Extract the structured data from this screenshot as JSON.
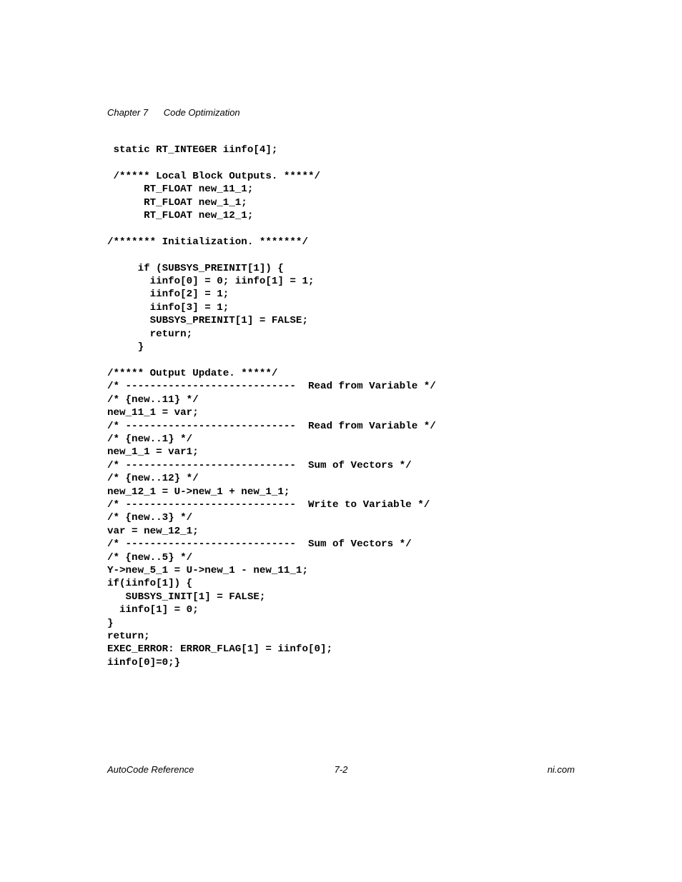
{
  "header": {
    "chapter_label": "Chapter 7",
    "chapter_title": "Code Optimization"
  },
  "code": " static RT_INTEGER iinfo[4];\n\n /***** Local Block Outputs. *****/\n      RT_FLOAT new_11_1;\n      RT_FLOAT new_1_1;\n      RT_FLOAT new_12_1;\n\n/******* Initialization. *******/\n\n     if (SUBSYS_PREINIT[1]) {\n       iinfo[0] = 0; iinfo[1] = 1;\n       iinfo[2] = 1;\n       iinfo[3] = 1;\n       SUBSYS_PREINIT[1] = FALSE;\n       return;\n     }\n\n/***** Output Update. *****/\n/* ----------------------------  Read from Variable */\n/* {new..11} */\nnew_11_1 = var;\n/* ----------------------------  Read from Variable */\n/* {new..1} */\nnew_1_1 = var1;\n/* ----------------------------  Sum of Vectors */\n/* {new..12} */\nnew_12_1 = U->new_1 + new_1_1;\n/* ----------------------------  Write to Variable */\n/* {new..3} */\nvar = new_12_1;\n/* ----------------------------  Sum of Vectors */\n/* {new..5} */\nY->new_5_1 = U->new_1 - new_11_1;\nif(iinfo[1]) {\n   SUBSYS_INIT[1] = FALSE;\n  iinfo[1] = 0;\n}\nreturn;\nEXEC_ERROR: ERROR_FLAG[1] = iinfo[0];\niinfo[0]=0;}",
  "footer": {
    "left": "AutoCode Reference",
    "center": "7-2",
    "right": "ni.com"
  }
}
